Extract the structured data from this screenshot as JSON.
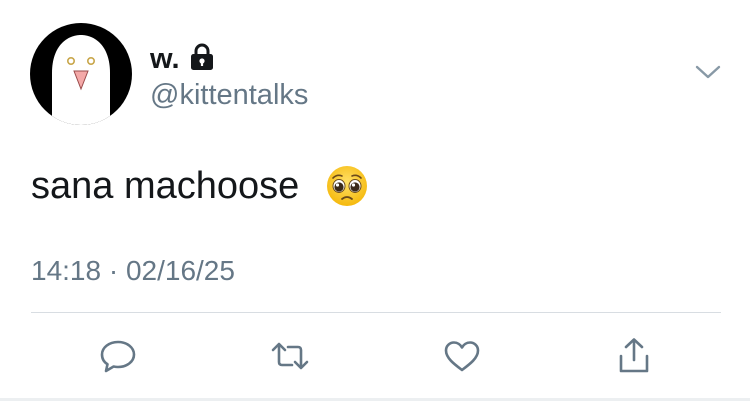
{
  "user": {
    "display_name": "w.",
    "handle": "@kittentalks",
    "protected": true,
    "avatar": "ghost-avatar"
  },
  "tweet": {
    "text": "sana machoose",
    "emoji": "pleading-face-emoji",
    "timestamp": "14:18 · 02/16/25"
  },
  "actions": [
    {
      "name": "reply",
      "icon": "reply-icon"
    },
    {
      "name": "retweet",
      "icon": "retweet-icon"
    },
    {
      "name": "like",
      "icon": "heart-icon"
    },
    {
      "name": "share",
      "icon": "share-icon"
    }
  ],
  "colors": {
    "text_primary": "#14171a",
    "text_secondary": "#657786",
    "divider": "#d8dde2",
    "icon_gray": "#657786"
  }
}
